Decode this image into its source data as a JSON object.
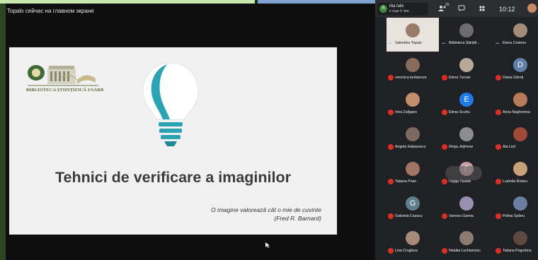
{
  "share_banner": "Topalo сейчас на главном экране",
  "slide": {
    "logo_caption": "BIBLIOTECA ȘTIINȚIFICĂ USARB",
    "title": "Tehnici de verificare a imaginilor",
    "quote_line1": "O imagine valorează cât o mie de cuvinte",
    "quote_line2": "(Fred R. Barnard)"
  },
  "topbar": {
    "notif_name": "rita Iulic",
    "notif_sub": "е еще 6 чел.",
    "notif_initial": "R",
    "time": "10:12",
    "icons": [
      "people-icon",
      "chat-icon",
      "activities-icon"
    ],
    "people_count": "25"
  },
  "participants": [
    {
      "name": "Valentina Topalo",
      "initial": "",
      "color": "#9a7b6a",
      "muted": false,
      "active": true
    },
    {
      "name": "Biblioteca Științifi...",
      "initial": "",
      "color": "#6d6d6d",
      "muted": false,
      "active": false
    },
    {
      "name": "Elena Croitoru",
      "initial": "",
      "color": "#a58b7a",
      "muted": false,
      "active": false
    },
    {
      "name": "veronica berbarova",
      "initial": "",
      "color": "#8a6a5a",
      "muted": true,
      "active": false
    },
    {
      "name": "Elena Turcan",
      "initial": "",
      "color": "#b8a89a",
      "muted": true,
      "active": false
    },
    {
      "name": "Diana Gărnă",
      "initial": "D",
      "color": "#5f7ea8",
      "muted": true,
      "active": false
    },
    {
      "name": "Irina Zaligaev",
      "initial": "",
      "color": "#c58d6b",
      "muted": true,
      "active": false
    },
    {
      "name": "Elena Scurtu",
      "initial": "E",
      "color": "#1e7be6",
      "muted": true,
      "active": false
    },
    {
      "name": "Anna Naghemea",
      "initial": "",
      "color": "#b77b59",
      "muted": true,
      "active": false
    },
    {
      "name": "Angela Habasescu",
      "initial": "",
      "color": "#7b6b5f",
      "muted": true,
      "active": false
    },
    {
      "name": "Игорь Афтени",
      "initial": "",
      "color": "#8d8d8d",
      "muted": true,
      "active": false
    },
    {
      "name": "Ala Lisii",
      "initial": "",
      "color": "#a04b3a",
      "muted": true,
      "active": false
    },
    {
      "name": "Tatiana Prian",
      "initial": "",
      "color": "#a07563",
      "muted": true,
      "active": false
    },
    {
      "name": "Герда Палий",
      "initial": "Г",
      "color": "#c9a0a8",
      "muted": true,
      "active": false
    },
    {
      "name": "Ludmila Rotaru",
      "initial": "",
      "color": "#caa27a",
      "muted": true,
      "active": false
    },
    {
      "name": "Gabriela Cazacu",
      "initial": "G",
      "color": "#607d8b",
      "muted": true,
      "active": false
    },
    {
      "name": "Varvara Ganna",
      "initial": "",
      "color": "#9b8fb0",
      "muted": true,
      "active": false
    },
    {
      "name": "Polina Spânu",
      "initial": "",
      "color": "#6b7da0",
      "muted": true,
      "active": false
    },
    {
      "name": "Lina Cruglova",
      "initial": "",
      "color": "#a68b7a",
      "muted": true,
      "active": false
    },
    {
      "name": "Natalia Luchianciuc",
      "initial": "",
      "color": "#8b7b70",
      "muted": true,
      "active": false
    },
    {
      "name": "Tatiana Pogrebna",
      "initial": "",
      "color": "#5c4a40",
      "muted": true,
      "active": false
    }
  ]
}
